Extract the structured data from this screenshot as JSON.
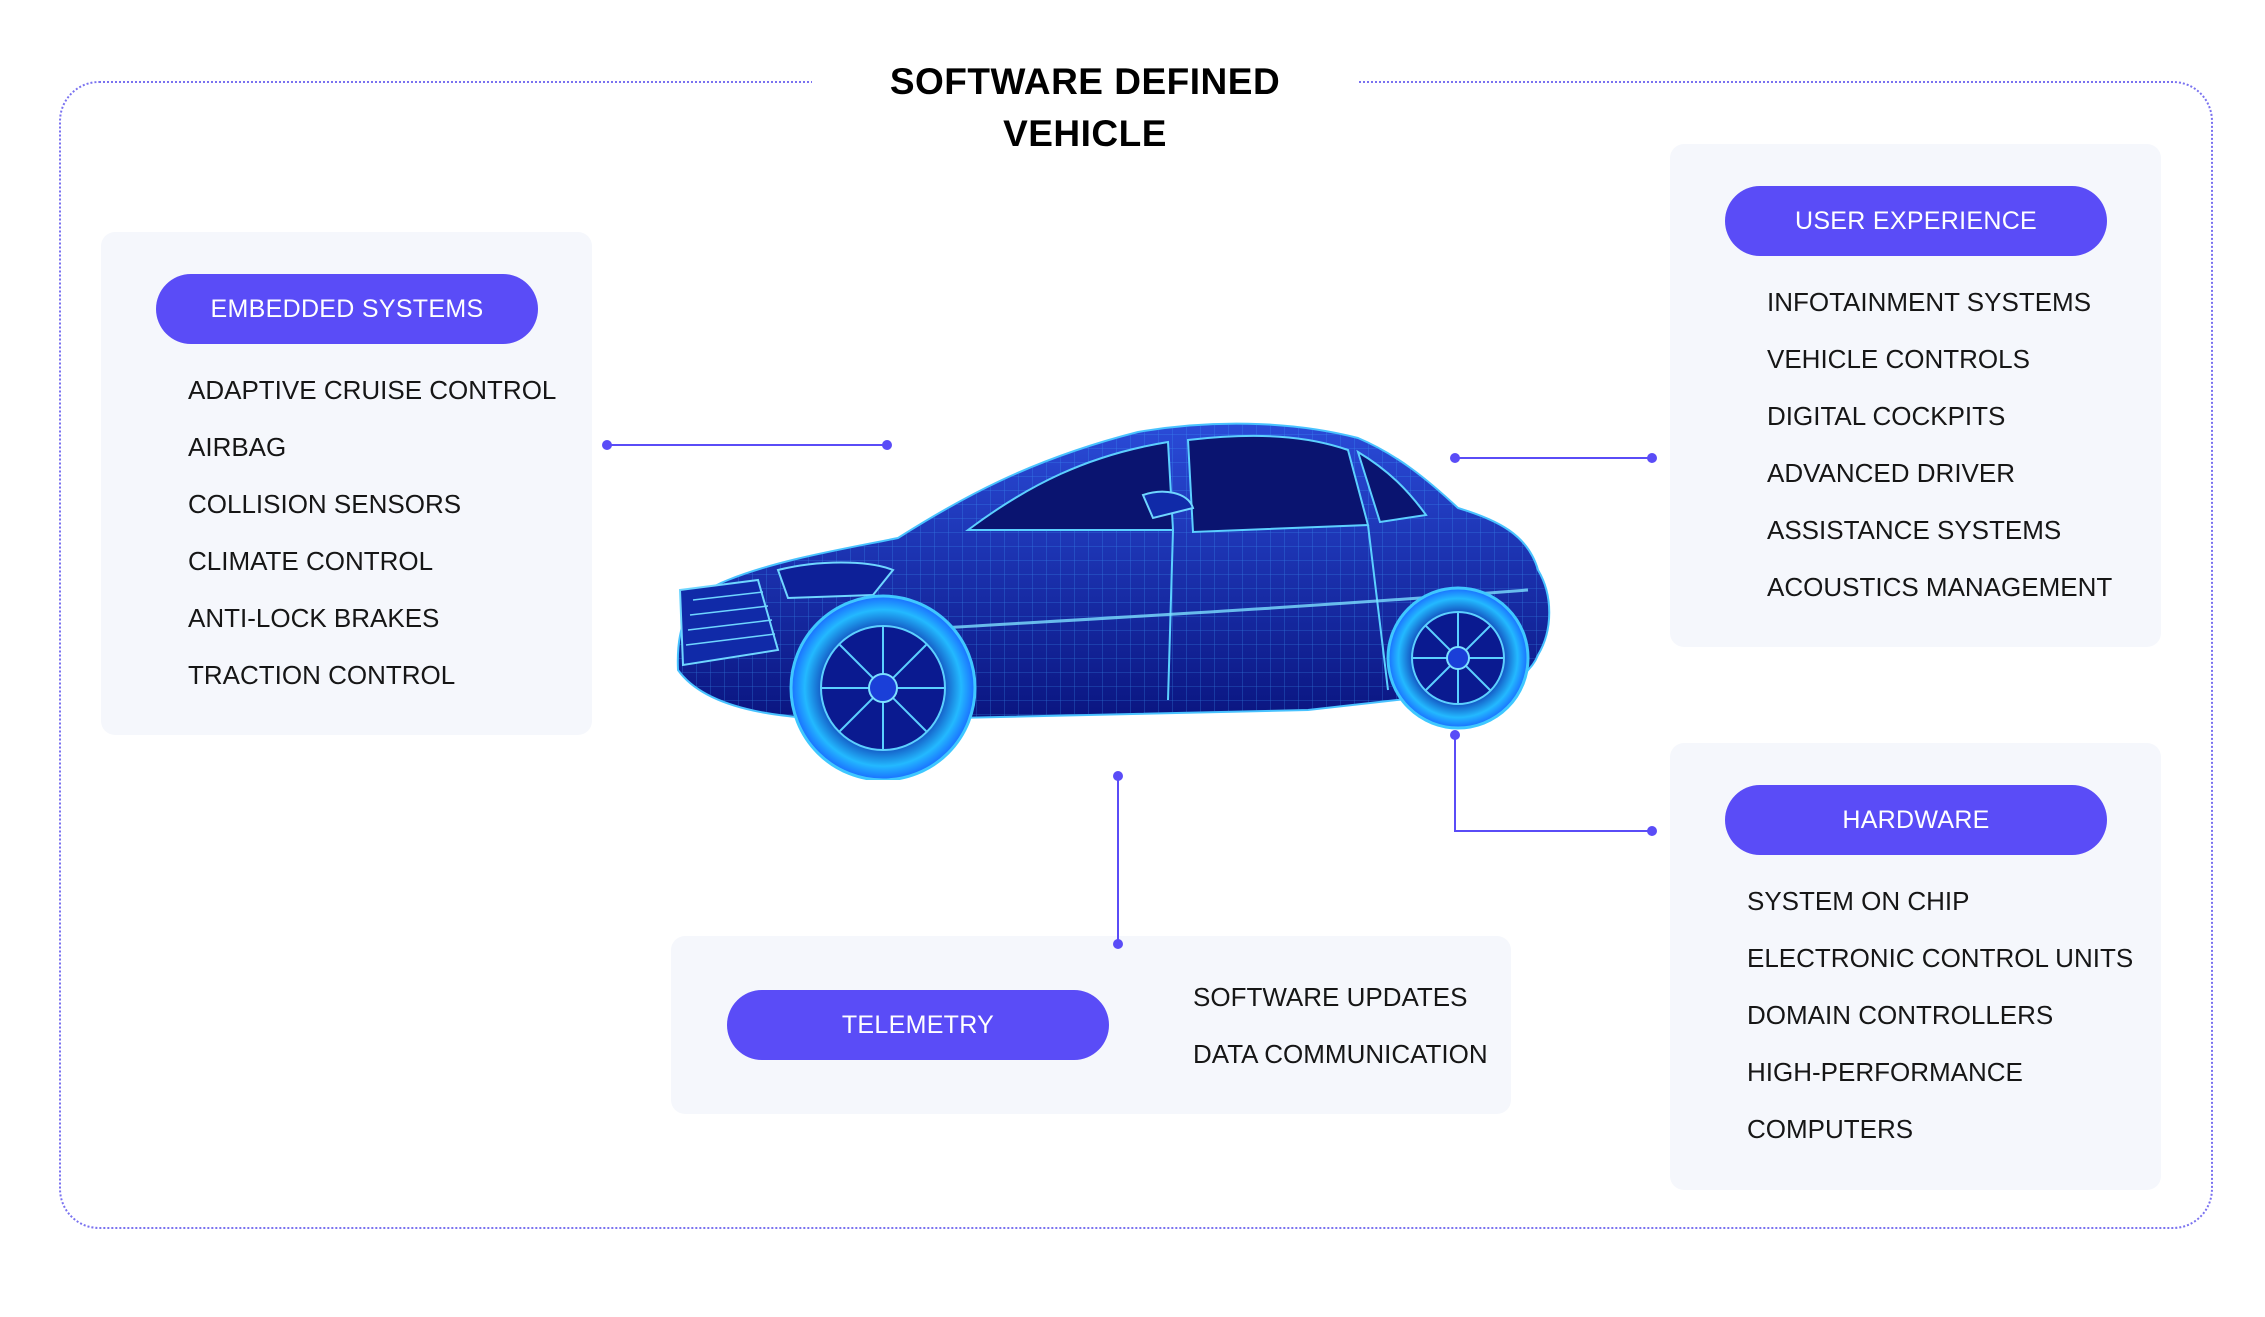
{
  "title": "SOFTWARE DEFINED VEHICLE",
  "colors": {
    "accent": "#5a4cf7",
    "panel_bg": "#f5f7fc",
    "car_glow": "#1fb8ff",
    "car_body": "#0b1a8f"
  },
  "embedded": {
    "label": "EMBEDDED SYSTEMS",
    "items": [
      "ADAPTIVE CRUISE CONTROL",
      "AIRBAG",
      "COLLISION SENSORS",
      "CLIMATE CONTROL",
      "ANTI-LOCK BRAKES",
      "TRACTION CONTROL"
    ]
  },
  "ux": {
    "label": "USER EXPERIENCE",
    "items": [
      "INFOTAINMENT SYSTEMS",
      "VEHICLE CONTROLS",
      "DIGITAL COCKPITS",
      "ADVANCED DRIVER",
      "ASSISTANCE SYSTEMS",
      "ACOUSTICS MANAGEMENT"
    ]
  },
  "hardware": {
    "label": "HARDWARE",
    "items": [
      "SYSTEM ON CHIP",
      "ELECTRONIC CONTROL UNITS",
      "DOMAIN CONTROLLERS",
      "HIGH-PERFORMANCE",
      "COMPUTERS"
    ]
  },
  "telemetry": {
    "label": "TELEMETRY",
    "items": [
      "SOFTWARE UPDATES",
      "DATA COMMUNICATION"
    ]
  }
}
